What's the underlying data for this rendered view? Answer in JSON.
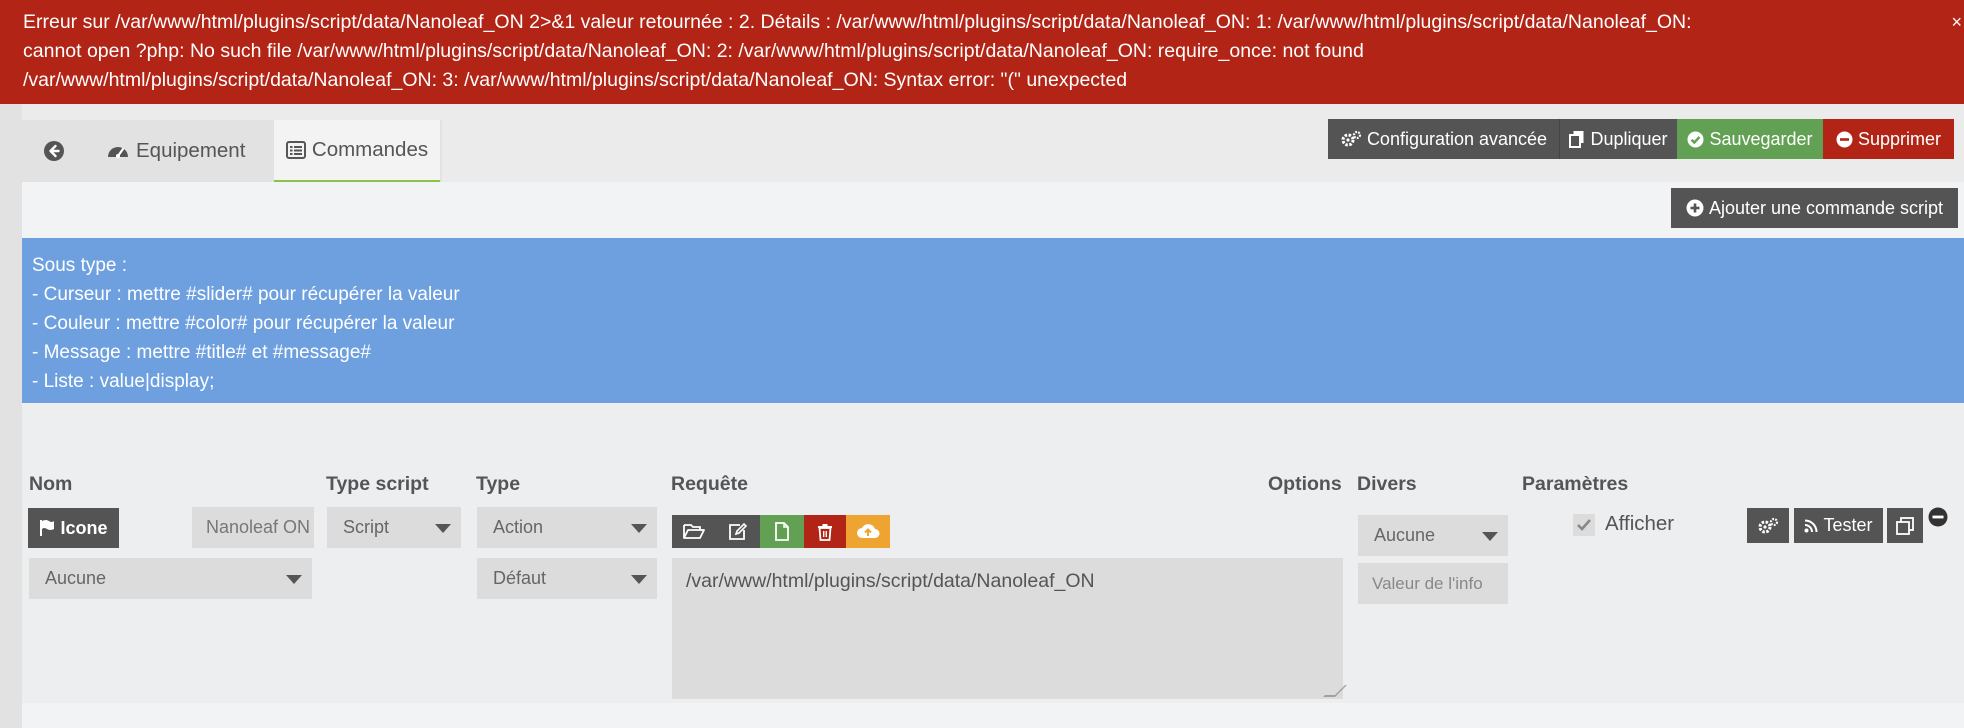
{
  "error": {
    "line1": "Erreur sur /var/www/html/plugins/script/data/Nanoleaf_ON 2>&1 valeur retournée : 2. Détails : /var/www/html/plugins/script/data/Nanoleaf_ON: 1: /var/www/html/plugins/script/data/Nanoleaf_ON:",
    "line2": "cannot open ?php: No such file /var/www/html/plugins/script/data/Nanoleaf_ON: 2: /var/www/html/plugins/script/data/Nanoleaf_ON: require_once: not found",
    "line3": "/var/www/html/plugins/script/data/Nanoleaf_ON: 3: /var/www/html/plugins/script/data/Nanoleaf_ON: Syntax error: \"(\" unexpected",
    "close": "×"
  },
  "tabs": [
    {
      "label": "",
      "icon": "arrow-left-circle-icon"
    },
    {
      "label": "Equipement",
      "icon": "tachometer-icon"
    },
    {
      "label": "Commandes",
      "icon": "list-alt-icon"
    }
  ],
  "toolbar": {
    "config_label": "Configuration avancée",
    "duplicate_label": "Dupliquer",
    "save_label": "Sauvegarder",
    "delete_label": "Supprimer",
    "add_command_label": "Ajouter une commande script"
  },
  "info": {
    "lines": [
      "Sous type :",
      "- Curseur : mettre #slider# pour récupérer la valeur",
      "- Couleur : mettre #color# pour récupérer la valeur",
      "- Message : mettre #title# et #message#",
      "- Liste : value|display;"
    ]
  },
  "table": {
    "headers": {
      "nom": "Nom",
      "type_script": "Type script",
      "type": "Type",
      "requete": "Requête",
      "options": "Options",
      "divers": "Divers",
      "parametres": "Paramètres"
    },
    "row": {
      "icon_button": "Icone",
      "name": "Nanoleaf ON",
      "parent_select": "Aucune",
      "type_script": "Script",
      "type": "Action",
      "subtype": "Défaut",
      "request": "/var/www/html/plugins/script/data/Nanoleaf_ON",
      "divers_select": "Aucune",
      "info_value_placeholder": "Valeur de l'info",
      "show_label": "Afficher",
      "test_label": "Tester"
    }
  },
  "colors": {
    "error": "#b22415",
    "info": "#6ea0e0",
    "save": "#62a153",
    "upload": "#efa431",
    "dark_button": "#545454"
  }
}
